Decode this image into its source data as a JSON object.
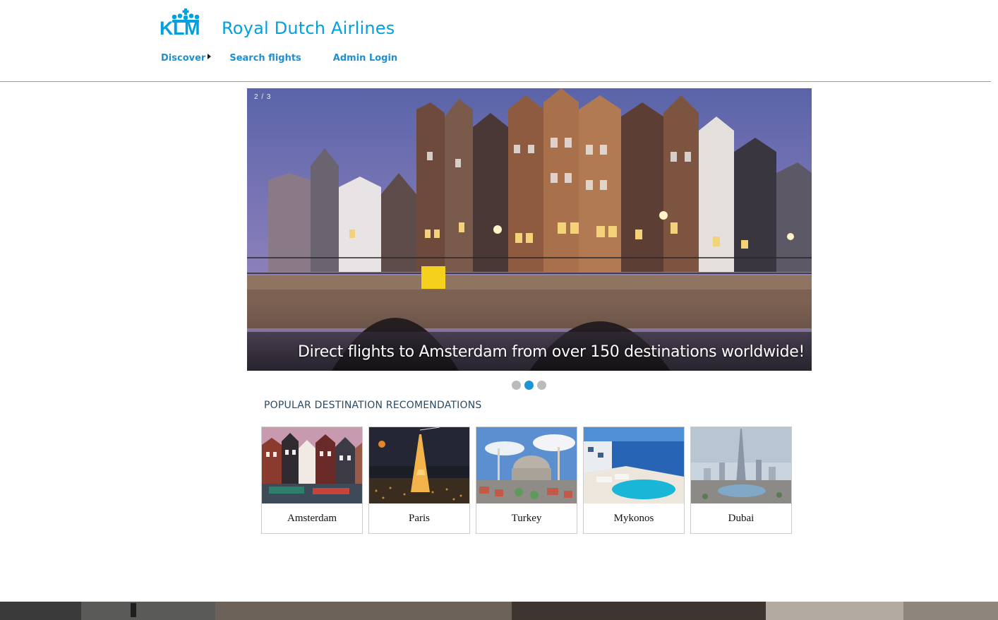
{
  "brand": {
    "logo_text": "KLM",
    "name": "Royal Dutch Airlines",
    "color": "#00a1de"
  },
  "nav": {
    "discover": "Discover",
    "search_flights": "Search flights",
    "admin_login": "Admin Login"
  },
  "slideshow": {
    "counter": "2 / 3",
    "caption": "Direct flights to Amsterdam from over 150 destinations worldwide!",
    "total": 3,
    "active_index": 2
  },
  "recommendations": {
    "title": "POPULAR DESTINATION RECOMENDATIONS",
    "cards": [
      {
        "label": "Amsterdam"
      },
      {
        "label": "Paris"
      },
      {
        "label": "Turkey"
      },
      {
        "label": "Mykonos"
      },
      {
        "label": "Dubai"
      }
    ]
  },
  "colors": {
    "accent": "#1e95d3",
    "nav_text": "#1e8fd1",
    "title_text": "#2c4a63"
  }
}
